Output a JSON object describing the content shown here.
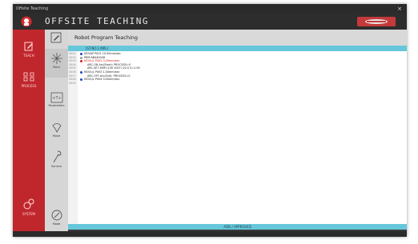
{
  "window": {
    "title": "Offsite Teaching",
    "close_glyph": "×"
  },
  "header": {
    "brand": "OFFSITE TEACHING",
    "logo_icon": "robot-logo-icon",
    "badge_icon": "brand-badge-icon"
  },
  "colors": {
    "sidebar": "#c0272d",
    "accent_bar": "#66c7db",
    "header": "#2d2d2d",
    "red_text": "#d42020",
    "blue_dot": "#1d46c4"
  },
  "sidebar": {
    "items": [
      {
        "label": "TEACH",
        "icon": "edit-icon"
      },
      {
        "label": "PROCESS",
        "icon": "process-icon"
      },
      {
        "label": "SYSTEM",
        "icon": "gears-icon"
      }
    ]
  },
  "subnav": {
    "items": [
      {
        "label": "Point",
        "icon": "point-icon"
      },
      {
        "label": "Parameters",
        "icon": "parameters-icon"
      },
      {
        "label": "Move",
        "icon": "move-icon"
      },
      {
        "label": "Service",
        "icon": "service-icon"
      },
      {
        "label": "Mode",
        "icon": "mode-icon"
      }
    ]
  },
  "panel": {
    "title": "Robot Program Teaching"
  },
  "program": {
    "header_label": "[ST.NO.1.MPL]",
    "footer_label": "ADD / APPROVED",
    "lines": [
      {
        "num": "0001",
        "text": "MOVJ/P P001 10.00mm/sec",
        "dot": "#1d46c4",
        "indent": false,
        "red": false
      },
      {
        "num": "0002",
        "text": "PRM BB440008",
        "dot": "#999999",
        "indent": false,
        "red": false
      },
      {
        "num": "0003",
        "text": "MOVL/L P002 3.00mm/sec",
        "dot": "#d42020",
        "indent": false,
        "red": true
      },
      {
        "num": "0004",
        "text": "ARC-ON Arc(Start): PROCESS=0",
        "dot": "",
        "indent": true,
        "red": false
      },
      {
        "num": "0005",
        "text": "ARC-SET AMP=100 VOLT=20.0 S=1.00",
        "dot": "",
        "indent": true,
        "red": false
      },
      {
        "num": "0006",
        "text": "MOVL/L P003 1.00mm/sec",
        "dot": "#1d46c4",
        "indent": false,
        "red": false
      },
      {
        "num": "0007",
        "text": "ARC-OFF Arc(End): PROCESS=0",
        "dot": "",
        "indent": true,
        "red": false
      },
      {
        "num": "0008",
        "text": "MOVL/L P004 3.00mm/sec",
        "dot": "#1d46c4",
        "indent": false,
        "red": false
      },
      {
        "num": "0009",
        "text": "",
        "dot": "",
        "indent": false,
        "red": false
      }
    ]
  }
}
